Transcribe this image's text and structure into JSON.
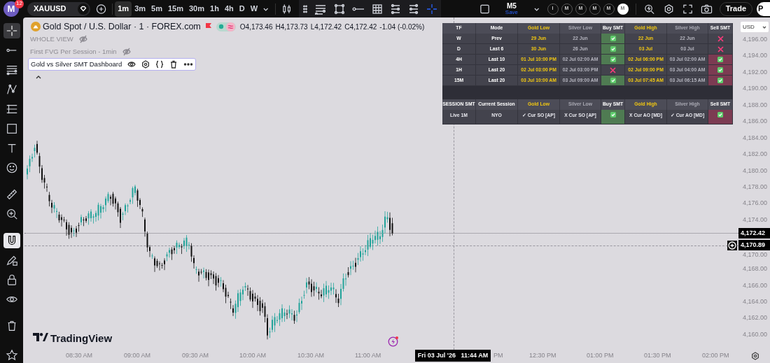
{
  "top_bar": {
    "avatar": {
      "initial": "M",
      "badge": "12"
    },
    "symbol": "XAUUSD",
    "intervals": [
      {
        "label": "1m",
        "selected": true
      },
      {
        "label": "3m",
        "selected": false
      },
      {
        "label": "5m",
        "selected": false
      },
      {
        "label": "15m",
        "selected": false
      },
      {
        "label": "30m",
        "selected": false
      },
      {
        "label": "1h",
        "selected": false
      },
      {
        "label": "4h",
        "selected": false
      },
      {
        "label": "D",
        "selected": false
      },
      {
        "label": "W",
        "selected": false
      }
    ],
    "layout": {
      "name": "M5",
      "action": "Save"
    },
    "layout_buttons": [
      {
        "label": "I",
        "selected": false
      },
      {
        "label": "M",
        "selected": false
      },
      {
        "label": "M",
        "selected": false
      },
      {
        "label": "M",
        "selected": false
      },
      {
        "label": "M",
        "selected": false
      },
      {
        "label": "M",
        "selected": true
      }
    ],
    "trade_button": "Trade",
    "profile_button": "P"
  },
  "left_toolbar": [
    {
      "selected": true
    },
    {
      "selected": false
    },
    {
      "selected": false
    },
    {
      "selected": false
    },
    {
      "selected": false
    },
    {
      "selected": false
    },
    {
      "selected": false
    },
    {
      "selected": false
    },
    {
      "selected": false
    },
    {
      "selected": false
    },
    {
      "selected": true
    },
    {
      "selected": false
    },
    {
      "selected": false
    },
    {
      "selected": false
    },
    {
      "selected": false
    },
    {
      "selected": false
    }
  ],
  "legend": {
    "title": "Gold Spot / U.S. Dollar · 1 · FOREX.com",
    "ohlc": [
      {
        "label": "O",
        "value": "4,173.46"
      },
      {
        "label": "H",
        "value": "4,173.73"
      },
      {
        "label": "L",
        "value": "4,172.42"
      },
      {
        "label": "C",
        "value": "4,172.42"
      }
    ],
    "change": "-1.04 (-0.02%)",
    "indicators": [
      {
        "name": "WHOLE VIEW",
        "hidden": true,
        "selected": false
      },
      {
        "name": "First FVG Per Session - 1min",
        "hidden": true,
        "selected": false
      },
      {
        "name": "Gold vs Silver SMT Dashboard",
        "hidden": false,
        "selected": true
      }
    ]
  },
  "dashboard": {
    "tables": [
      {
        "tinted": true,
        "columns": [
          {
            "label": "TF",
            "kind": "plain"
          },
          {
            "label": "Mode",
            "kind": "plain"
          },
          {
            "label": "Gold Low",
            "kind": "gold"
          },
          {
            "label": "Silver Low",
            "kind": "silver"
          },
          {
            "label": "Buy SMT",
            "kind": "buy"
          },
          {
            "label": "Gold High",
            "kind": "gold"
          },
          {
            "label": "Silver High",
            "kind": "silver"
          },
          {
            "label": "Sell SMT",
            "kind": "sell"
          }
        ],
        "rows": [
          {
            "cells": [
              {
                "kind": "text",
                "text": "W"
              },
              {
                "kind": "text",
                "text": "Prev"
              },
              {
                "kind": "text",
                "text": "29 Jun"
              },
              {
                "kind": "text",
                "text": "22 Jun"
              },
              {
                "kind": "check"
              },
              {
                "kind": "text",
                "text": "22 Jun"
              },
              {
                "kind": "text",
                "text": "22 Jun"
              },
              {
                "kind": "cross"
              }
            ]
          },
          {
            "cells": [
              {
                "kind": "text",
                "text": "D"
              },
              {
                "kind": "text",
                "text": "Last 6"
              },
              {
                "kind": "text",
                "text": "30 Jun"
              },
              {
                "kind": "text",
                "text": "26 Jun"
              },
              {
                "kind": "check"
              },
              {
                "kind": "text",
                "text": "03 Jul"
              },
              {
                "kind": "text",
                "text": "03 Jul"
              },
              {
                "kind": "cross"
              }
            ]
          },
          {
            "cells": [
              {
                "kind": "text",
                "text": "4H"
              },
              {
                "kind": "text",
                "text": "Last 10"
              },
              {
                "kind": "text",
                "text": "01 Jul 10:00 PM"
              },
              {
                "kind": "text",
                "text": "02 Jul 02:00 AM"
              },
              {
                "kind": "check"
              },
              {
                "kind": "text",
                "text": "02 Jul 06:00 PM"
              },
              {
                "kind": "text",
                "text": "03 Jul 02:00 AM"
              },
              {
                "kind": "check"
              }
            ]
          },
          {
            "cells": [
              {
                "kind": "text",
                "text": "1H"
              },
              {
                "kind": "text",
                "text": "Last 20"
              },
              {
                "kind": "text",
                "text": "02 Jul 03:00 PM"
              },
              {
                "kind": "text",
                "text": "02 Jul 03:00 PM"
              },
              {
                "kind": "cross"
              },
              {
                "kind": "text",
                "text": "02 Jul 09:00 PM"
              },
              {
                "kind": "text",
                "text": "03 Jul 04:00 AM"
              },
              {
                "kind": "check"
              }
            ]
          },
          {
            "cells": [
              {
                "kind": "text",
                "text": "15M"
              },
              {
                "kind": "text",
                "text": "Last 20"
              },
              {
                "kind": "text",
                "text": "03 Jul 10:00 AM"
              },
              {
                "kind": "text",
                "text": "03 Jul 09:00 AM"
              },
              {
                "kind": "check"
              },
              {
                "kind": "text",
                "text": "03 Jul 07:45 AM"
              },
              {
                "kind": "text",
                "text": "03 Jul 06:15 AM"
              },
              {
                "kind": "check"
              }
            ]
          }
        ]
      },
      {
        "tinted": false,
        "columns": [
          {
            "label": "SESSION SMT",
            "kind": "plain"
          },
          {
            "label": "Current Session",
            "kind": "plain"
          },
          {
            "label": "Gold Low",
            "kind": "gold"
          },
          {
            "label": "Silver Low",
            "kind": "silver"
          },
          {
            "label": "Buy SMT",
            "kind": "buy"
          },
          {
            "label": "Gold High",
            "kind": "gold"
          },
          {
            "label": "Silver High",
            "kind": "silver"
          },
          {
            "label": "Sell SMT",
            "kind": "sell"
          }
        ],
        "rows": [
          {
            "cells": [
              {
                "kind": "text",
                "text": "Live 1M"
              },
              {
                "kind": "text",
                "text": "NYO"
              },
              {
                "kind": "text",
                "text": "✓ Cur SO [AP]"
              },
              {
                "kind": "text",
                "text": "X Cur SO [AP]"
              },
              {
                "kind": "check"
              },
              {
                "kind": "text",
                "text": "X Cur AO [MD]"
              },
              {
                "kind": "text",
                "text": "✓ Cur AO [MD]"
              },
              {
                "kind": "check"
              }
            ]
          }
        ]
      }
    ]
  },
  "price_axis": {
    "currency": "USD",
    "labels": [
      "4,196.00",
      "4,194.00",
      "4,192.00",
      "4,190.00",
      "4,188.00",
      "4,186.00",
      "4,184.00",
      "4,182.00",
      "4,180.00",
      "4,178.00",
      "4,176.00",
      "4,174.00"
    ],
    "labels_below": [
      "4,170.00",
      "4,168.00",
      "4,166.00",
      "4,164.00",
      "4,162.00",
      "4,160.00"
    ],
    "last_price": "4,172.42",
    "crosshair_price": "4,170.89"
  },
  "time_axis": {
    "labels": [
      "08:30 AM",
      "09:00 AM",
      "09:30 AM",
      "10:00 AM",
      "10:30 AM",
      "11:00 AM",
      "PM",
      "12:30 PM",
      "01:00 PM",
      "01:30 PM",
      "02:00 PM"
    ],
    "crosshair_time": "Fri 03 Jul '26   11:44 AM"
  },
  "brand": "TradingView"
}
